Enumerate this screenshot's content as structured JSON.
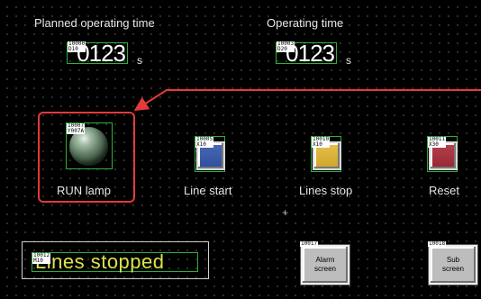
{
  "planned": {
    "label": "Planned operating time",
    "tag": "10000\nD10",
    "value": "0123",
    "unit": "s"
  },
  "operating": {
    "label": "Operating time",
    "tag": "10003\nD20",
    "value": "0123",
    "unit": "s"
  },
  "run_lamp": {
    "label": "RUN lamp",
    "tag": "10007\nY007A"
  },
  "line_start": {
    "label": "Line start",
    "tag": "10005\nX10"
  },
  "lines_stop": {
    "label": "Lines stop",
    "tag": "10010\nX10"
  },
  "reset": {
    "label": "Reset",
    "tag": "10011\nX30"
  },
  "status": {
    "tag": "10012\nM10",
    "text": "Lines stopped"
  },
  "alarm_screen": {
    "tag": "10017",
    "label": "Alarm\nscreen"
  },
  "sub_screen": {
    "tag": "10018",
    "label": "Sub\nscreen"
  },
  "colors": {
    "highlight": "#e33a3a",
    "object_outline": "#2fae3c",
    "status_text": "#d9e34a"
  }
}
